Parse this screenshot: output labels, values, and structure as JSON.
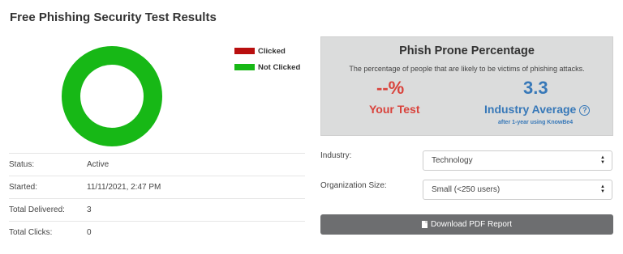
{
  "page": {
    "title": "Free Phishing Security Test Results"
  },
  "chart_data": {
    "type": "pie",
    "categories": [
      "Clicked",
      "Not Clicked"
    ],
    "values": [
      0,
      3
    ],
    "colors": [
      "#b90f0f",
      "#17b816"
    ],
    "legend_position": "top-right"
  },
  "legend": [
    {
      "label": "Clicked",
      "color": "#b90f0f"
    },
    {
      "label": "Not Clicked",
      "color": "#17b816"
    }
  ],
  "stats": [
    {
      "label": "Status:",
      "value": "Active"
    },
    {
      "label": "Started:",
      "value": "11/11/2021, 2:47 PM"
    },
    {
      "label": "Total Delivered:",
      "value": "3"
    },
    {
      "label": "Total Clicks:",
      "value": "0"
    }
  ],
  "phish_prone": {
    "title": "Phish Prone Percentage",
    "description": "The percentage of people that are likely to be victims of phishing attacks.",
    "your_test_value": "--%",
    "your_test_label": "Your Test",
    "industry_value": "3.3",
    "industry_label": "Industry Average",
    "industry_subtext": "after 1-year using KnowBe4"
  },
  "form": {
    "industry_label": "Industry:",
    "industry_value": "Technology",
    "size_label": "Organization Size:",
    "size_value": "Small (<250 users)"
  },
  "download": {
    "label": "Download PDF Report"
  },
  "colors": {
    "clicked": "#b90f0f",
    "not_clicked": "#17b816",
    "accent_red": "#d9423b",
    "accent_blue": "#3778b8"
  }
}
